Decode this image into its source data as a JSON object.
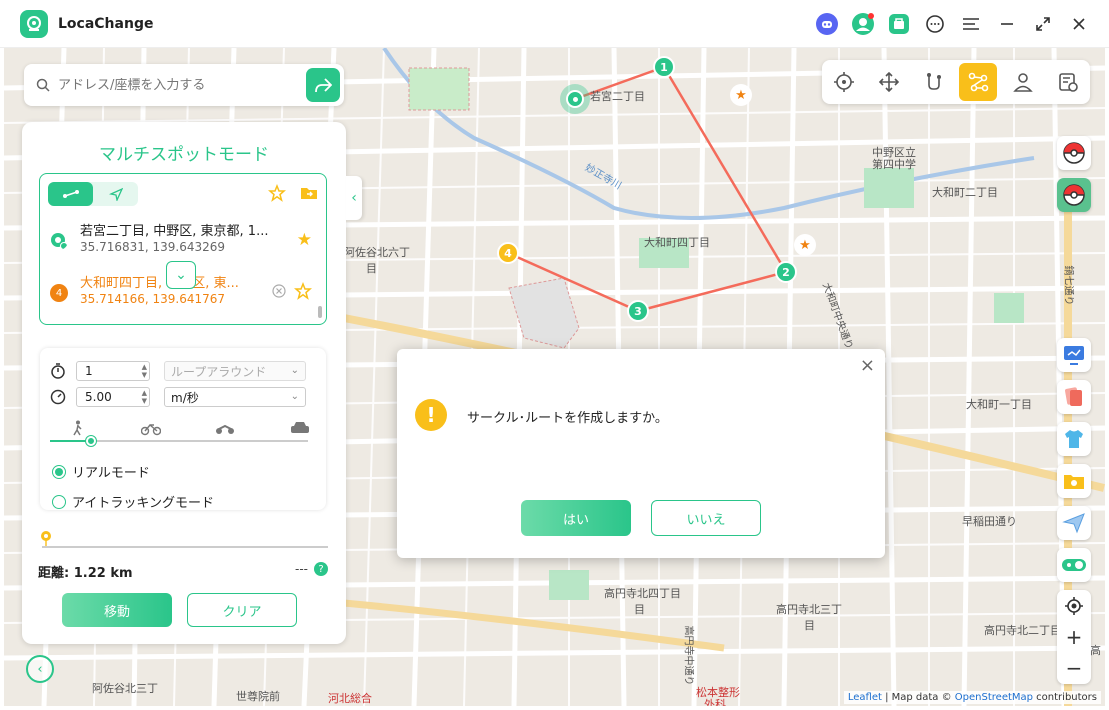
{
  "app": {
    "title": "LocaChange"
  },
  "search": {
    "placeholder": "アドレス/座標を入力する"
  },
  "panel": {
    "title": "マルチスポットモード",
    "spots": [
      {
        "name": "若宮二丁目, 中野区, 東京都, 1...",
        "coords": "35.716831, 139.643269",
        "marker_color": "#2ac58a"
      },
      {
        "index": "4",
        "name": "大和町四丁目, 中野区, 東...",
        "coords": "35.714166, 139.641767",
        "marker_color": "#f08312"
      }
    ],
    "loop_count": "1",
    "loop_mode": "ループアラウンド",
    "speed": "5.00",
    "speed_unit": "m/秒",
    "speed_level": 0.16,
    "modes": {
      "real": "リアルモード",
      "eye": "アイトラッキングモード"
    },
    "distance_label": "距離:",
    "distance_value": "1.22 km",
    "time_value": "---",
    "move_label": "移動",
    "clear_label": "クリア"
  },
  "dialog": {
    "message": "サークル･ルートを作成しますか。",
    "yes_label": "はい",
    "no_label": "いいえ"
  },
  "map": {
    "labels": [
      "若宮二丁目",
      "中野区立",
      "第四中学",
      "大和町二丁目",
      "大和町四丁目",
      "阿佐谷北六丁",
      "目",
      "妙正寺川",
      "大和町中央通り",
      "大和町一丁目",
      "早稲田通り",
      "高円寺北四丁目",
      "目",
      "高円寺北三丁",
      "目",
      "高円寺北二丁目",
      "阿佐谷北三丁",
      "世尊院前",
      "河北総合",
      "松本整形",
      "外科",
      "高円寺中通り",
      "鍋七通り",
      "高"
    ],
    "route_nodes": [
      "1",
      "2",
      "3",
      "4"
    ],
    "attribution": {
      "leaflet": "Leaflet",
      "data": " | Map data © ",
      "osm": "OpenStreetMap",
      "contrib": " contributors"
    }
  },
  "colors": {
    "accent": "#2ac58a",
    "route": "#f46b5b",
    "warn": "#f9bf1a",
    "orange": "#f08312"
  }
}
